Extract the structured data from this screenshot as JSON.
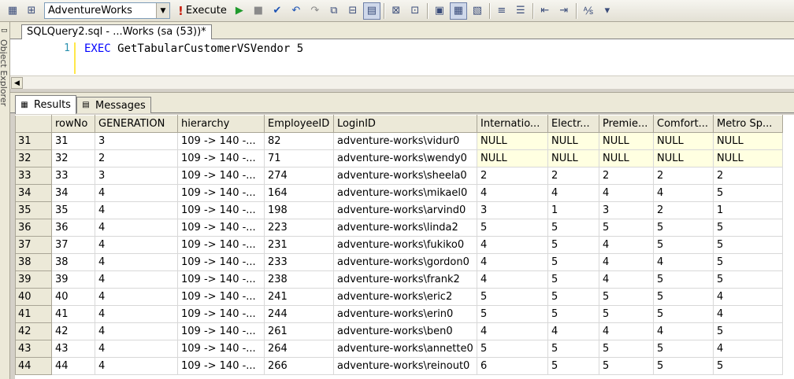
{
  "toolbar": {
    "database": "AdventureWorks",
    "execute_label": "Execute"
  },
  "object_explorer": {
    "label": "Object Explorer"
  },
  "document_tab": {
    "title": "SQLQuery2.sql - ...Works (sa (53))*"
  },
  "editor": {
    "line_number": "1",
    "keyword": "EXEC",
    "statement": " GetTabularCustomerVSVendor 5"
  },
  "result_tabs": {
    "results": "Results",
    "messages": "Messages"
  },
  "grid": {
    "columns": [
      "rowNo",
      "GENERATION",
      "hierarchy",
      "EmployeeID",
      "LoginID",
      "Internatio...",
      "Electr...",
      "Premie...",
      "Comfort...",
      "Metro Sp..."
    ],
    "rows": [
      [
        "31",
        "31",
        "3",
        "109 -> 140 -...",
        "82",
        "adventure-works\\vidur0",
        "NULL",
        "NULL",
        "NULL",
        "NULL",
        "NULL"
      ],
      [
        "32",
        "32",
        "2",
        "109 -> 140 -...",
        "71",
        "adventure-works\\wendy0",
        "NULL",
        "NULL",
        "NULL",
        "NULL",
        "NULL"
      ],
      [
        "33",
        "33",
        "3",
        "109 -> 140 -...",
        "274",
        "adventure-works\\sheela0",
        "2",
        "2",
        "2",
        "2",
        "2"
      ],
      [
        "34",
        "34",
        "4",
        "109 -> 140 -...",
        "164",
        "adventure-works\\mikael0",
        "4",
        "4",
        "4",
        "4",
        "5"
      ],
      [
        "35",
        "35",
        "4",
        "109 -> 140 -...",
        "198",
        "adventure-works\\arvind0",
        "3",
        "1",
        "3",
        "2",
        "1"
      ],
      [
        "36",
        "36",
        "4",
        "109 -> 140 -...",
        "223",
        "adventure-works\\linda2",
        "5",
        "5",
        "5",
        "5",
        "5"
      ],
      [
        "37",
        "37",
        "4",
        "109 -> 140 -...",
        "231",
        "adventure-works\\fukiko0",
        "4",
        "5",
        "4",
        "5",
        "5"
      ],
      [
        "38",
        "38",
        "4",
        "109 -> 140 -...",
        "233",
        "adventure-works\\gordon0",
        "4",
        "5",
        "4",
        "4",
        "5"
      ],
      [
        "39",
        "39",
        "4",
        "109 -> 140 -...",
        "238",
        "adventure-works\\frank2",
        "4",
        "5",
        "4",
        "5",
        "5"
      ],
      [
        "40",
        "40",
        "4",
        "109 -> 140 -...",
        "241",
        "adventure-works\\eric2",
        "5",
        "5",
        "5",
        "5",
        "4"
      ],
      [
        "41",
        "41",
        "4",
        "109 -> 140 -...",
        "244",
        "adventure-works\\erin0",
        "5",
        "5",
        "5",
        "5",
        "4"
      ],
      [
        "42",
        "42",
        "4",
        "109 -> 140 -...",
        "261",
        "adventure-works\\ben0",
        "4",
        "4",
        "4",
        "4",
        "5"
      ],
      [
        "43",
        "43",
        "4",
        "109 -> 140 -...",
        "264",
        "adventure-works\\annette0",
        "5",
        "5",
        "5",
        "5",
        "4"
      ],
      [
        "44",
        "44",
        "4",
        "109 -> 140 -...",
        "266",
        "adventure-works\\reinout0",
        "6",
        "5",
        "5",
        "5",
        "5"
      ]
    ]
  }
}
